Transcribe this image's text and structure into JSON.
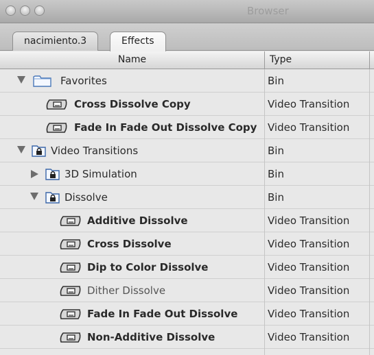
{
  "window": {
    "title": "Browser"
  },
  "tabs": [
    {
      "label": "nacimiento.3"
    },
    {
      "label": "Effects"
    }
  ],
  "columns": {
    "name": "Name",
    "type": "Type"
  },
  "rows": [
    {
      "name": "Favorites",
      "type": "Bin",
      "kind": "folder",
      "expanded": true,
      "bold": false
    },
    {
      "name": "Cross Dissolve Copy",
      "type": "Video Transition",
      "kind": "transition",
      "bold": true
    },
    {
      "name": "Fade In Fade Out Dissolve Copy",
      "type": "Video Transition",
      "kind": "transition",
      "bold": true
    },
    {
      "name": "Video Transitions",
      "type": "Bin",
      "kind": "locked-bin",
      "expanded": true,
      "bold": false
    },
    {
      "name": "3D Simulation",
      "type": "Bin",
      "kind": "locked-bin",
      "expanded": false,
      "bold": false
    },
    {
      "name": "Dissolve",
      "type": "Bin",
      "kind": "locked-bin",
      "expanded": true,
      "bold": false
    },
    {
      "name": "Additive Dissolve",
      "type": "Video Transition",
      "kind": "transition",
      "bold": true
    },
    {
      "name": "Cross Dissolve",
      "type": "Video Transition",
      "kind": "transition",
      "bold": true
    },
    {
      "name": "Dip to Color Dissolve",
      "type": "Video Transition",
      "kind": "transition",
      "bold": true
    },
    {
      "name": "Dither Dissolve",
      "type": "Video Transition",
      "kind": "transition",
      "bold": false
    },
    {
      "name": "Fade In Fade Out Dissolve",
      "type": "Video Transition",
      "kind": "transition",
      "bold": true
    },
    {
      "name": "Non-Additive Dissolve",
      "type": "Video Transition",
      "kind": "transition",
      "bold": true
    }
  ]
}
